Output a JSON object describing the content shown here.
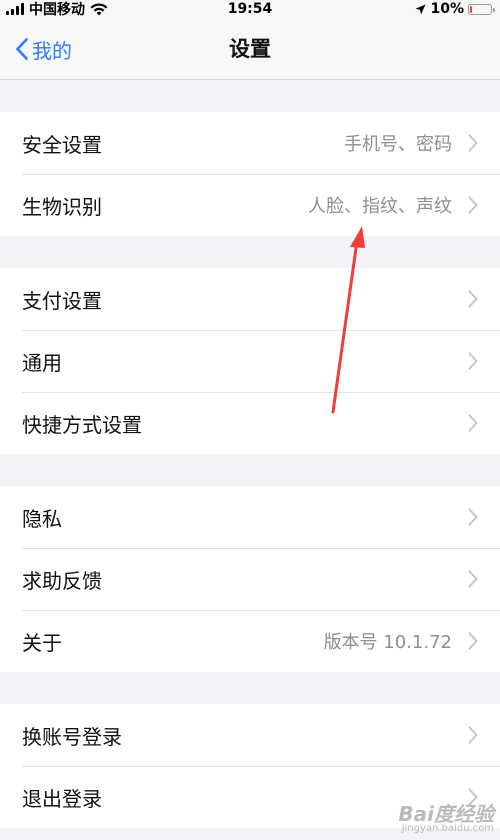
{
  "status_bar": {
    "carrier": "中国移动",
    "time": "19:54",
    "battery": "10%",
    "battery_level": 0.1,
    "battery_color": "#ff3b30"
  },
  "nav": {
    "back_label": "我的",
    "title": "设置",
    "accent_color": "#2f7cf6"
  },
  "groups": [
    {
      "rows": [
        {
          "label": "安全设置",
          "value": "手机号、密码"
        },
        {
          "label": "生物识别",
          "value": "人脸、指纹、声纹"
        }
      ]
    },
    {
      "rows": [
        {
          "label": "支付设置",
          "value": ""
        },
        {
          "label": "通用",
          "value": ""
        },
        {
          "label": "快捷方式设置",
          "value": ""
        }
      ]
    },
    {
      "rows": [
        {
          "label": "隐私",
          "value": ""
        },
        {
          "label": "求助反馈",
          "value": ""
        },
        {
          "label": "关于",
          "value": "版本号 10.1.72"
        }
      ]
    },
    {
      "rows": [
        {
          "label": "换账号登录",
          "value": ""
        },
        {
          "label": "退出登录",
          "value": ""
        }
      ]
    }
  ],
  "watermark": {
    "line1": "Bai度经验",
    "line2": "jingyan.baidu.com"
  },
  "icons": {
    "back": "chevron-left-icon",
    "row_chevron": "chevron-right-icon",
    "wifi": "wifi-icon",
    "location": "location-arrow-icon",
    "battery": "battery-icon",
    "signal": "signal-icon"
  }
}
